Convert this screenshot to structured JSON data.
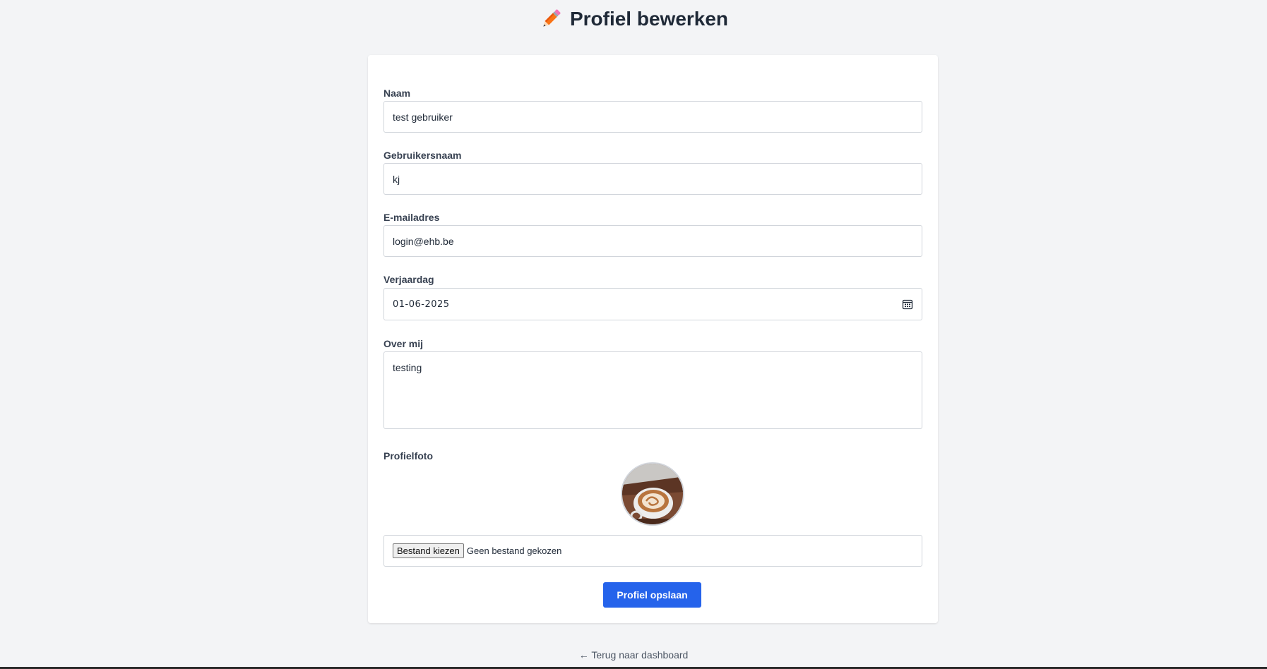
{
  "header": {
    "title": "Profiel bewerken",
    "icon": "pencil-icon"
  },
  "form": {
    "name": {
      "label": "Naam",
      "value": "test gebruiker"
    },
    "username": {
      "label": "Gebruikersnaam",
      "value": "kj"
    },
    "email": {
      "label": "E-mailadres",
      "value": "login@ehb.be"
    },
    "birthday": {
      "label": "Verjaardag",
      "value": "01-06-2025",
      "icon": "calendar-icon"
    },
    "about": {
      "label": "Over mij",
      "value": "testing"
    },
    "photo": {
      "label": "Profielfoto",
      "choose_button": "Bestand kiezen",
      "no_file_text": "Geen bestand gekozen"
    },
    "save_button": "Profiel opslaan"
  },
  "footer": {
    "back_link": "← Terug naar dashboard"
  },
  "colors": {
    "accent": "#2563eb",
    "background": "#f3f4f6",
    "pencil": "#f97316"
  }
}
